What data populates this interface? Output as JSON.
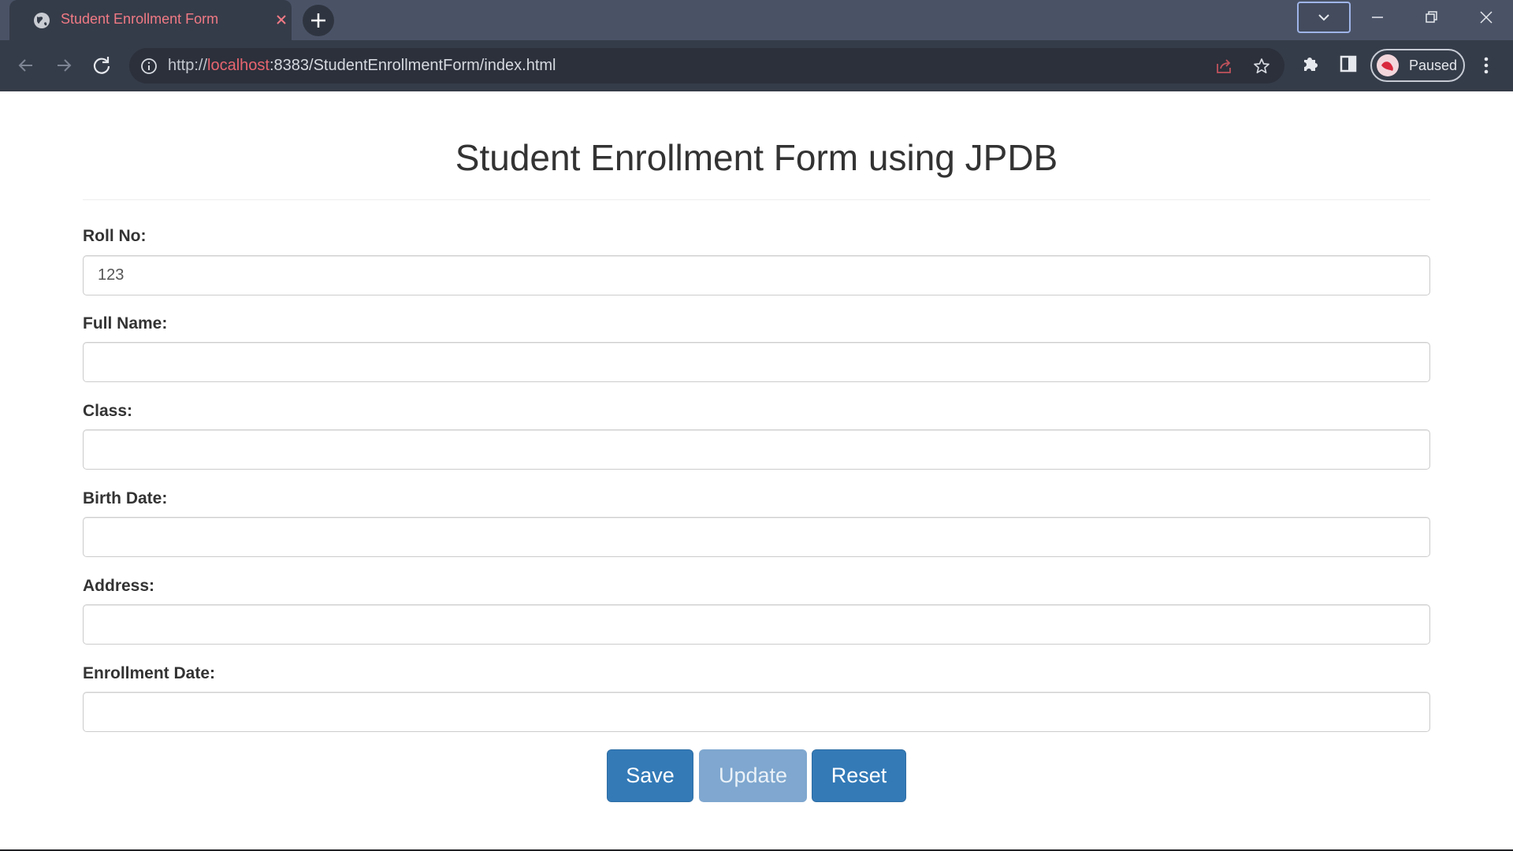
{
  "browser": {
    "tab": {
      "title": "Student Enrollment Form"
    },
    "address_bar": {
      "scheme": "http://",
      "host": "localhost",
      "rest": ":8383/StudentEnrollmentForm/index.html"
    },
    "profile": {
      "label": "Paused"
    },
    "icons": {
      "tab_favicon": "globe-icon",
      "tab_close": "close-icon",
      "new_tab": "plus-icon",
      "tab_search": "chevron-down-icon",
      "back": "arrow-left-icon",
      "forward": "arrow-right-icon",
      "reload": "reload-icon",
      "site_info": "info-icon",
      "share": "share-icon",
      "bookmark": "star-icon",
      "extensions": "puzzle-icon",
      "side_panel": "side-panel-icon",
      "menu": "kebab-menu-icon"
    }
  },
  "form": {
    "title": "Student Enrollment Form using JPDB",
    "fields": {
      "roll_no": {
        "label": "Roll No:",
        "value": "123"
      },
      "full_name": {
        "label": "Full Name:",
        "value": ""
      },
      "class": {
        "label": "Class:",
        "value": ""
      },
      "birth_date": {
        "label": "Birth Date:",
        "value": ""
      },
      "address": {
        "label": "Address:",
        "value": ""
      },
      "enrollment_date": {
        "label": "Enrollment Date:",
        "value": ""
      }
    },
    "buttons": {
      "save": "Save",
      "update": "Update",
      "reset": "Reset"
    }
  },
  "colors": {
    "primary_button": "#337ab7",
    "disabled_button": "#7fa7cf",
    "tab_title": "#f07a85",
    "url_host": "#e8656f"
  }
}
